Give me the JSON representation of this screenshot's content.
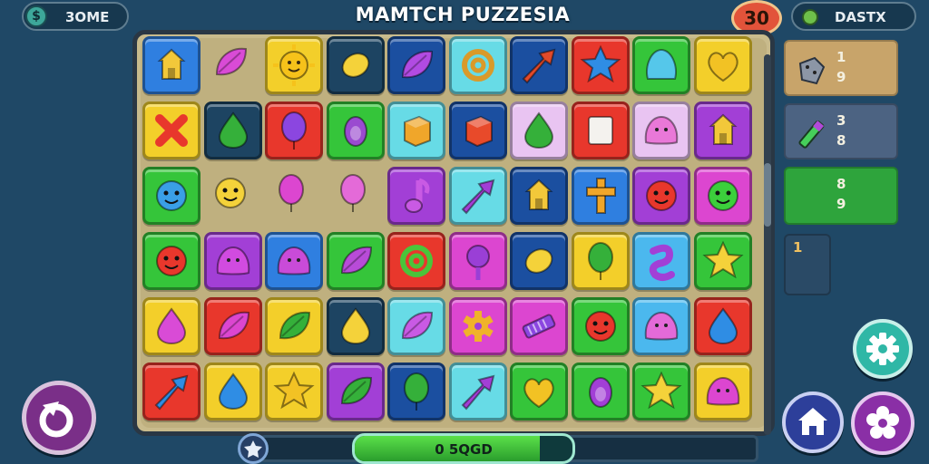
{
  "hud": {
    "score_icon_glyph": "$",
    "score_label": "3OME",
    "title": "MAMTCH PUZZESIA",
    "moves_value": "30",
    "dash_label": "DASTX"
  },
  "side_panels": [
    {
      "name": "side-panel-powerup-1",
      "icon": "dice-icon",
      "color": "#c8a46a",
      "line1": "1",
      "line2": "9"
    },
    {
      "name": "side-panel-powerup-2",
      "icon": "crayon-icon",
      "color": "#4c6382",
      "line1": "3",
      "line2": "8"
    },
    {
      "name": "side-panel-powerup-3",
      "icon": "",
      "color": "#2ea43c",
      "line1": "8",
      "line2": "9"
    },
    {
      "name": "side-panel-slot-4",
      "icon": "",
      "color": "#2a4a66",
      "line1": "1",
      "line2": ""
    }
  ],
  "progress": {
    "label": "0 5QGD",
    "fill_fraction": 0.85
  },
  "buttons": {
    "settings": "gear-icon",
    "home": "home-icon",
    "options": "flower-gear-icon",
    "back": "back-icon"
  },
  "colors": {
    "blue": "#2f7fe0",
    "yellow": "#f3cf2a",
    "dark": "#1d4462",
    "teal": "#67dbe6",
    "navy": "#1b4fa0",
    "red": "#e8372c",
    "green": "#35c53a",
    "purple": "#a23fd6",
    "magenta": "#dc46d0",
    "lightblue": "#4bb8ee",
    "pink": "#e9c4f2",
    "orange": "#f08b2a"
  },
  "board": {
    "rows": [
      [
        {
          "bg": "blue",
          "icon": "house-icon",
          "fg": "#f2c83a"
        },
        {
          "bg": "none",
          "icon": "leaf-icon",
          "fg": "#d94bd6"
        },
        {
          "bg": "yellow",
          "icon": "sun-face-icon",
          "fg": "#f6c21a"
        },
        {
          "bg": "dark",
          "icon": "lemon-icon",
          "fg": "#f4d23a"
        },
        {
          "bg": "navy",
          "icon": "leaf-icon",
          "fg": "#b14be2"
        },
        {
          "bg": "teal",
          "icon": "swirl-icon",
          "fg": "#d99a2a"
        },
        {
          "bg": "navy",
          "icon": "arrow-icon",
          "fg": "#e24a2a"
        },
        {
          "bg": "red",
          "icon": "star-icon",
          "fg": "#2f8de4"
        },
        {
          "bg": "green",
          "icon": "blob-icon",
          "fg": "#55c7ea"
        },
        {
          "bg": "yellow",
          "icon": "heart-icon",
          "fg": "#f2c224"
        }
      ],
      [
        {
          "bg": "yellow",
          "icon": "x-icon",
          "fg": "#e8372c"
        },
        {
          "bg": "dark",
          "icon": "drop-icon",
          "fg": "#35b03a"
        },
        {
          "bg": "red",
          "icon": "balloon-icon",
          "fg": "#8b46e0"
        },
        {
          "bg": "green",
          "icon": "egg-icon",
          "fg": "#9a4bd0"
        },
        {
          "bg": "teal",
          "icon": "cube-icon",
          "fg": "#f0a62a"
        },
        {
          "bg": "navy",
          "icon": "cube-icon",
          "fg": "#e84a2a"
        },
        {
          "bg": "pink",
          "icon": "drop-icon",
          "fg": "#35b03a"
        },
        {
          "bg": "red",
          "icon": "card-icon",
          "fg": "#f4f2ee"
        },
        {
          "bg": "pink",
          "icon": "jelly-icon",
          "fg": "#e978d8"
        },
        {
          "bg": "purple",
          "icon": "house-icon",
          "fg": "#f2c83a"
        }
      ],
      [
        {
          "bg": "green",
          "icon": "face-blob-icon",
          "fg": "#3a9fe6"
        },
        {
          "bg": "none",
          "icon": "face-blob-icon",
          "fg": "#f4d23a"
        },
        {
          "bg": "none",
          "icon": "balloon-icon",
          "fg": "#dc46d0"
        },
        {
          "bg": "none",
          "icon": "balloon-icon",
          "fg": "#e46ad8"
        },
        {
          "bg": "purple",
          "icon": "note-icon",
          "fg": "#c95ae4"
        },
        {
          "bg": "teal",
          "icon": "arrow-icon",
          "fg": "#a23fd6"
        },
        {
          "bg": "navy",
          "icon": "house-icon",
          "fg": "#f2c83a"
        },
        {
          "bg": "blue",
          "icon": "cross-icon",
          "fg": "#f0a62a"
        },
        {
          "bg": "purple",
          "icon": "face-blob-icon",
          "fg": "#e8372c"
        },
        {
          "bg": "magenta",
          "icon": "face-blob-icon",
          "fg": "#3ccf3c"
        }
      ],
      [
        {
          "bg": "green",
          "icon": "face-blob-icon",
          "fg": "#e8372c"
        },
        {
          "bg": "purple",
          "icon": "jelly-icon",
          "fg": "#d14be0"
        },
        {
          "bg": "blue",
          "icon": "jelly-icon",
          "fg": "#c94bd8"
        },
        {
          "bg": "green",
          "icon": "leaf-icon",
          "fg": "#b84bd8"
        },
        {
          "bg": "red",
          "icon": "swirl-icon",
          "fg": "#4ac43a"
        },
        {
          "bg": "magenta",
          "icon": "lollipop-icon",
          "fg": "#9a3fd6"
        },
        {
          "bg": "navy",
          "icon": "lemon-icon",
          "fg": "#f4d23a"
        },
        {
          "bg": "yellow",
          "icon": "balloon-icon",
          "fg": "#35b03a"
        },
        {
          "bg": "lightblue",
          "icon": "snake-icon",
          "fg": "#a23fd6"
        },
        {
          "bg": "green",
          "icon": "star-icon",
          "fg": "#f4d23a"
        }
      ],
      [
        {
          "bg": "yellow",
          "icon": "drop-icon",
          "fg": "#d94bd6"
        },
        {
          "bg": "red",
          "icon": "leaf-icon",
          "fg": "#dc46d0"
        },
        {
          "bg": "yellow",
          "icon": "leaf-icon",
          "fg": "#35b03a"
        },
        {
          "bg": "dark",
          "icon": "drop-icon",
          "fg": "#f4d23a"
        },
        {
          "bg": "teal",
          "icon": "leaf-icon",
          "fg": "#c95ae4"
        },
        {
          "bg": "magenta",
          "icon": "cog-icon",
          "fg": "#f0b22a"
        },
        {
          "bg": "magenta",
          "icon": "candy-icon",
          "fg": "#8b46e0"
        },
        {
          "bg": "green",
          "icon": "face-blob-icon",
          "fg": "#e8372c"
        },
        {
          "bg": "lightblue",
          "icon": "jelly-icon",
          "fg": "#e46ad8"
        },
        {
          "bg": "red",
          "icon": "drop-icon",
          "fg": "#2f8de4"
        }
      ],
      [
        {
          "bg": "red",
          "icon": "arrow-icon",
          "fg": "#2f8de4"
        },
        {
          "bg": "yellow",
          "icon": "drop-icon",
          "fg": "#2f8de4"
        },
        {
          "bg": "yellow",
          "icon": "star-icon",
          "fg": "#f2c224"
        },
        {
          "bg": "purple",
          "icon": "leaf-icon",
          "fg": "#35b03a"
        },
        {
          "bg": "navy",
          "icon": "balloon-icon",
          "fg": "#35b03a"
        },
        {
          "bg": "teal",
          "icon": "arrow-icon",
          "fg": "#a23fd6"
        },
        {
          "bg": "green",
          "icon": "heart-icon",
          "fg": "#f2c224"
        },
        {
          "bg": "green",
          "icon": "egg-icon",
          "fg": "#a23fd6"
        },
        {
          "bg": "green",
          "icon": "star-icon",
          "fg": "#f4d23a"
        },
        {
          "bg": "yellow",
          "icon": "jelly-icon",
          "fg": "#dc46d0"
        }
      ]
    ]
  }
}
